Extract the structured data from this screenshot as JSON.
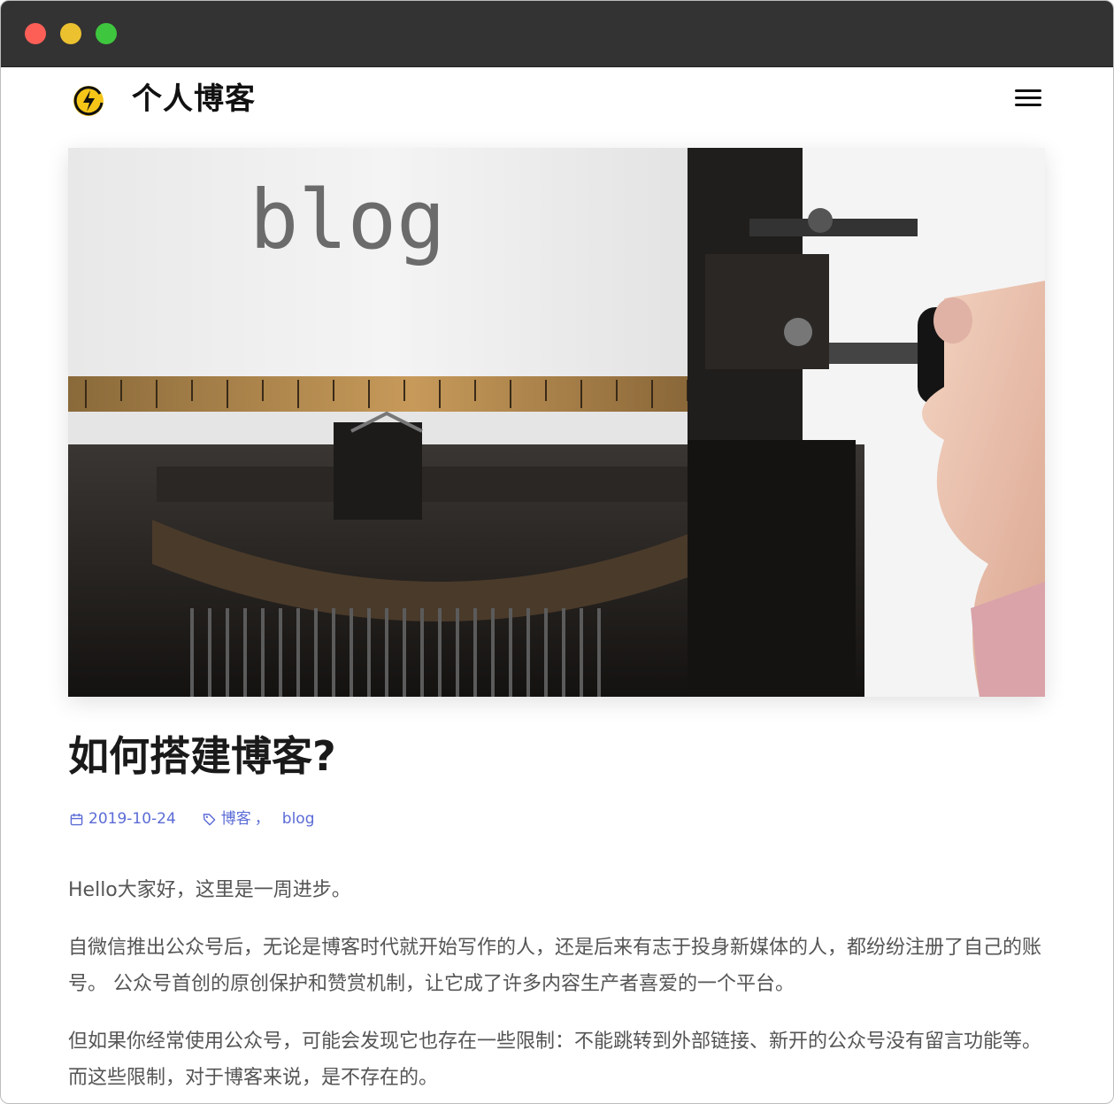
{
  "site": {
    "title": "个人博客"
  },
  "post": {
    "title": "如何搭建博客?",
    "date": "2019-10-24",
    "tags": [
      "博客",
      "blog"
    ],
    "tag_separator": "，",
    "paragraphs": [
      "Hello大家好，这里是一周进步。",
      "自微信推出公众号后，无论是博客时代就开始写作的人，还是后来有志于投身新媒体的人，都纷纷注册了自己的账号。 公众号首创的原创保护和赞赏机制，让它成了许多内容生产者喜爱的一个平台。",
      "但如果你经常使用公众号，可能会发现它也存在一些限制：不能跳转到外部链接、新开的公众号没有留言功能等。 而这些限制，对于博客来说，是不存在的。"
    ],
    "hero_text": "blog"
  },
  "colors": {
    "accent": "#5b6bd6",
    "titlebar": "#333333",
    "traffic_red": "#fd5f57",
    "traffic_yellow": "#ebc130",
    "traffic_green": "#3ec63e",
    "logo_yellow": "#f5c518"
  },
  "icons": {
    "logo": "lightning-logo-icon",
    "menu": "hamburger-menu-icon",
    "date": "calendar-icon",
    "tag": "tag-icon"
  }
}
